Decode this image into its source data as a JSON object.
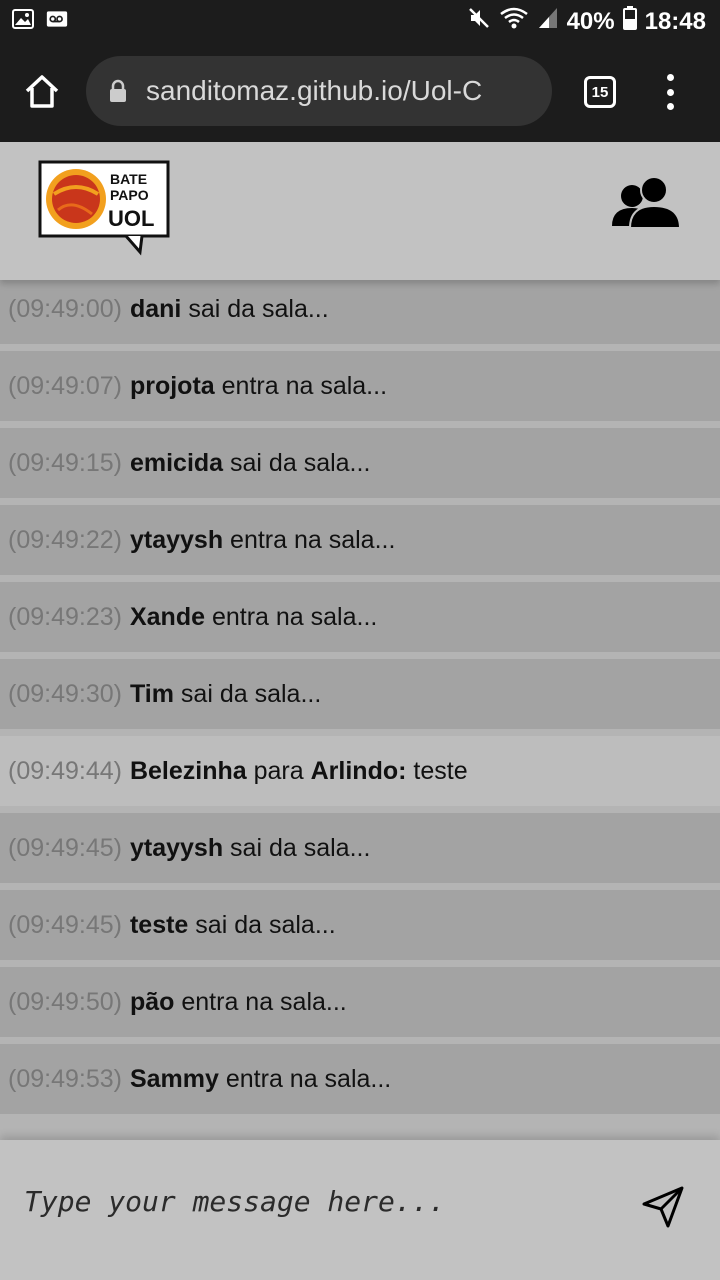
{
  "status_bar": {
    "battery": "40%",
    "time": "18:48"
  },
  "browser": {
    "url": "sanditomaz.github.io/Uol-C",
    "tab_count": "15"
  },
  "header": {
    "logo_text": "BATE PAPO UOL"
  },
  "messages": [
    {
      "time": "(09:49:00)",
      "from": "dani",
      "text": "sai da sala...",
      "type": "status"
    },
    {
      "time": "(09:49:07)",
      "from": "projota",
      "text": "entra na sala...",
      "type": "status"
    },
    {
      "time": "(09:49:15)",
      "from": "emicida",
      "text": "sai da sala...",
      "type": "status"
    },
    {
      "time": "(09:49:22)",
      "from": "ytayysh",
      "text": "entra na sala...",
      "type": "status"
    },
    {
      "time": "(09:49:23)",
      "from": "Xande",
      "text": "entra na sala...",
      "type": "status"
    },
    {
      "time": "(09:49:30)",
      "from": "Tim",
      "text": "sai da sala...",
      "type": "status"
    },
    {
      "time": "(09:49:44)",
      "from": "Belezinha",
      "connector": "para",
      "to": "Arlindo:",
      "text": "teste",
      "type": "private"
    },
    {
      "time": "(09:49:45)",
      "from": "ytayysh",
      "text": "sai da sala...",
      "type": "status"
    },
    {
      "time": "(09:49:45)",
      "from": "teste",
      "text": "sai da sala...",
      "type": "status"
    },
    {
      "time": "(09:49:50)",
      "from": "pão",
      "text": "entra na sala...",
      "type": "status"
    },
    {
      "time": "(09:49:53)",
      "from": "Sammy",
      "text": "entra na sala...",
      "type": "status"
    }
  ],
  "composer": {
    "placeholder": "Type your message here..."
  }
}
